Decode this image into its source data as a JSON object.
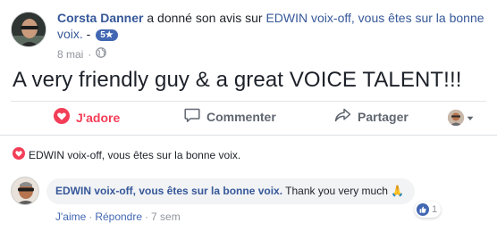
{
  "post": {
    "author": "Corsta Danner",
    "action_text": " a donné son avis sur ",
    "page_name": "EDWIN voix-off, vous êtes sur la bonne voix.",
    "separator": " - ",
    "rating": "5★",
    "date": "8 mai",
    "separator_dot": "·",
    "privacy_icon": "globe-icon",
    "body": "A very friendly guy & a great VOICE TALENT!!!"
  },
  "actions": {
    "like_label": "J'adore",
    "comment_label": "Commenter",
    "share_label": "Partager"
  },
  "comments": {
    "page_reaction_text": "EDWIN voix-off, vous êtes sur la bonne voix.",
    "items": [
      {
        "author": "EDWIN voix-off, vous êtes sur la bonne voix.",
        "text": " Thank you very much ",
        "emoji": "🙏",
        "reaction_count": "1",
        "like_label": "J'aime",
        "reply_label": "Répondre",
        "dot": "·",
        "time": "7 sem"
      }
    ]
  },
  "colors": {
    "link": "#365899",
    "love": "#f33e58",
    "muted": "#90949c",
    "accent": "#4267b2"
  }
}
